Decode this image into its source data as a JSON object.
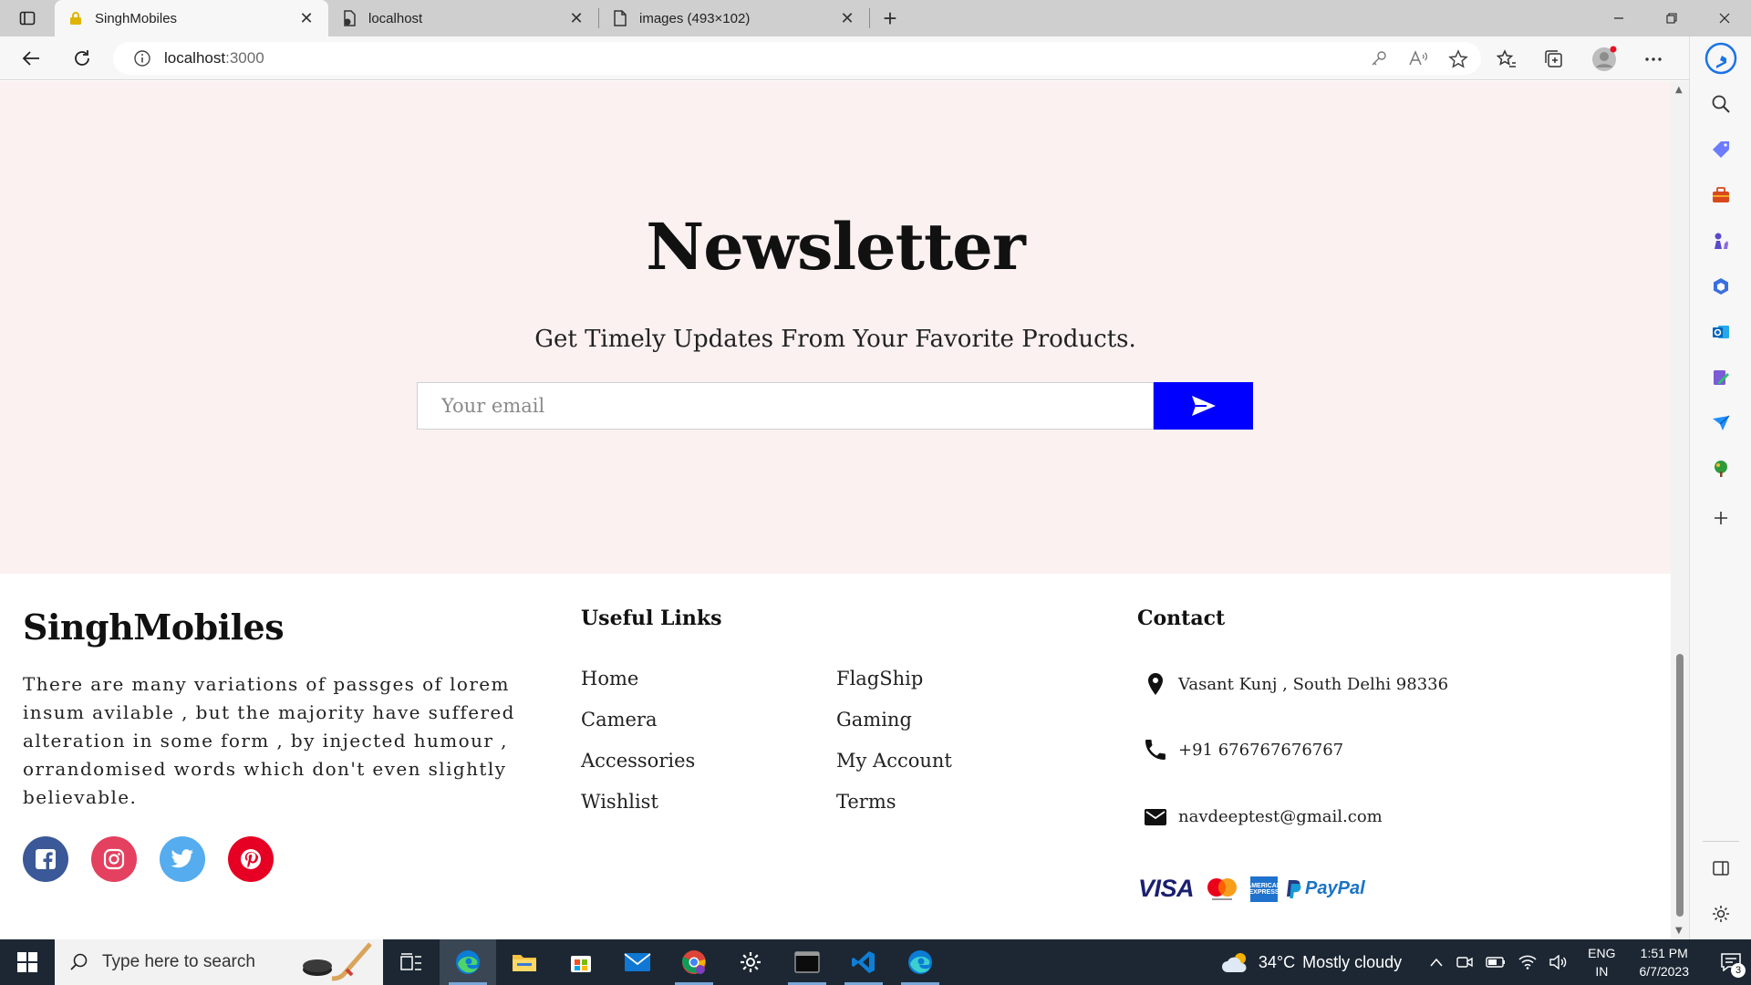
{
  "browser": {
    "tabs": [
      {
        "title": "SinghMobiles",
        "icon": "lock-favicon-icon",
        "active": true
      },
      {
        "title": "localhost",
        "icon": "page-sync-icon",
        "active": false
      },
      {
        "title": "images (493×102)",
        "icon": "document-icon",
        "active": false
      }
    ],
    "close_glyph": "✕",
    "new_tab_glyph": "+",
    "address": {
      "host": "localhost",
      "port": ":3000"
    }
  },
  "newsletter": {
    "title": "Newsletter",
    "subtitle": "Get Timely Updates From Your Favorite Products.",
    "email_placeholder": "Your email",
    "accent": "#0000ff",
    "background": "#fbf1f1"
  },
  "footer": {
    "brand": "SinghMobiles",
    "about": "There are many variations of passges of lorem insum avilable , but the majority have suffered alteration in some form , by injected humour , orrandomised words which don't even slightly believable.",
    "useful_links_heading": "Useful Links",
    "links_left": [
      "Home",
      "Camera",
      "Accessories",
      "Wishlist"
    ],
    "links_right": [
      "FlagShip",
      "Gaming",
      "My Account",
      "Terms"
    ],
    "contact_heading": "Contact",
    "contact": {
      "address": "Vasant Kunj , South Delhi 98336",
      "phone": "+91 676767676767",
      "email": "navdeeptest@gmail.com"
    },
    "payments": {
      "visa": "VISA",
      "amex": "AMERICAN EXPRESS",
      "paypal": "PayPal"
    },
    "social_colors": {
      "facebook": "#3b5998",
      "instagram": "#e4405f",
      "twitter": "#55acee",
      "pinterest": "#e60023"
    }
  },
  "taskbar": {
    "search_placeholder": "Type here to search",
    "weather": {
      "temp": "34°C",
      "condition": "Mostly cloudy"
    },
    "lang": {
      "top": "ENG",
      "bottom": "IN"
    },
    "clock": {
      "time": "1:51 PM",
      "date": "6/7/2023"
    },
    "notifications": "3"
  }
}
